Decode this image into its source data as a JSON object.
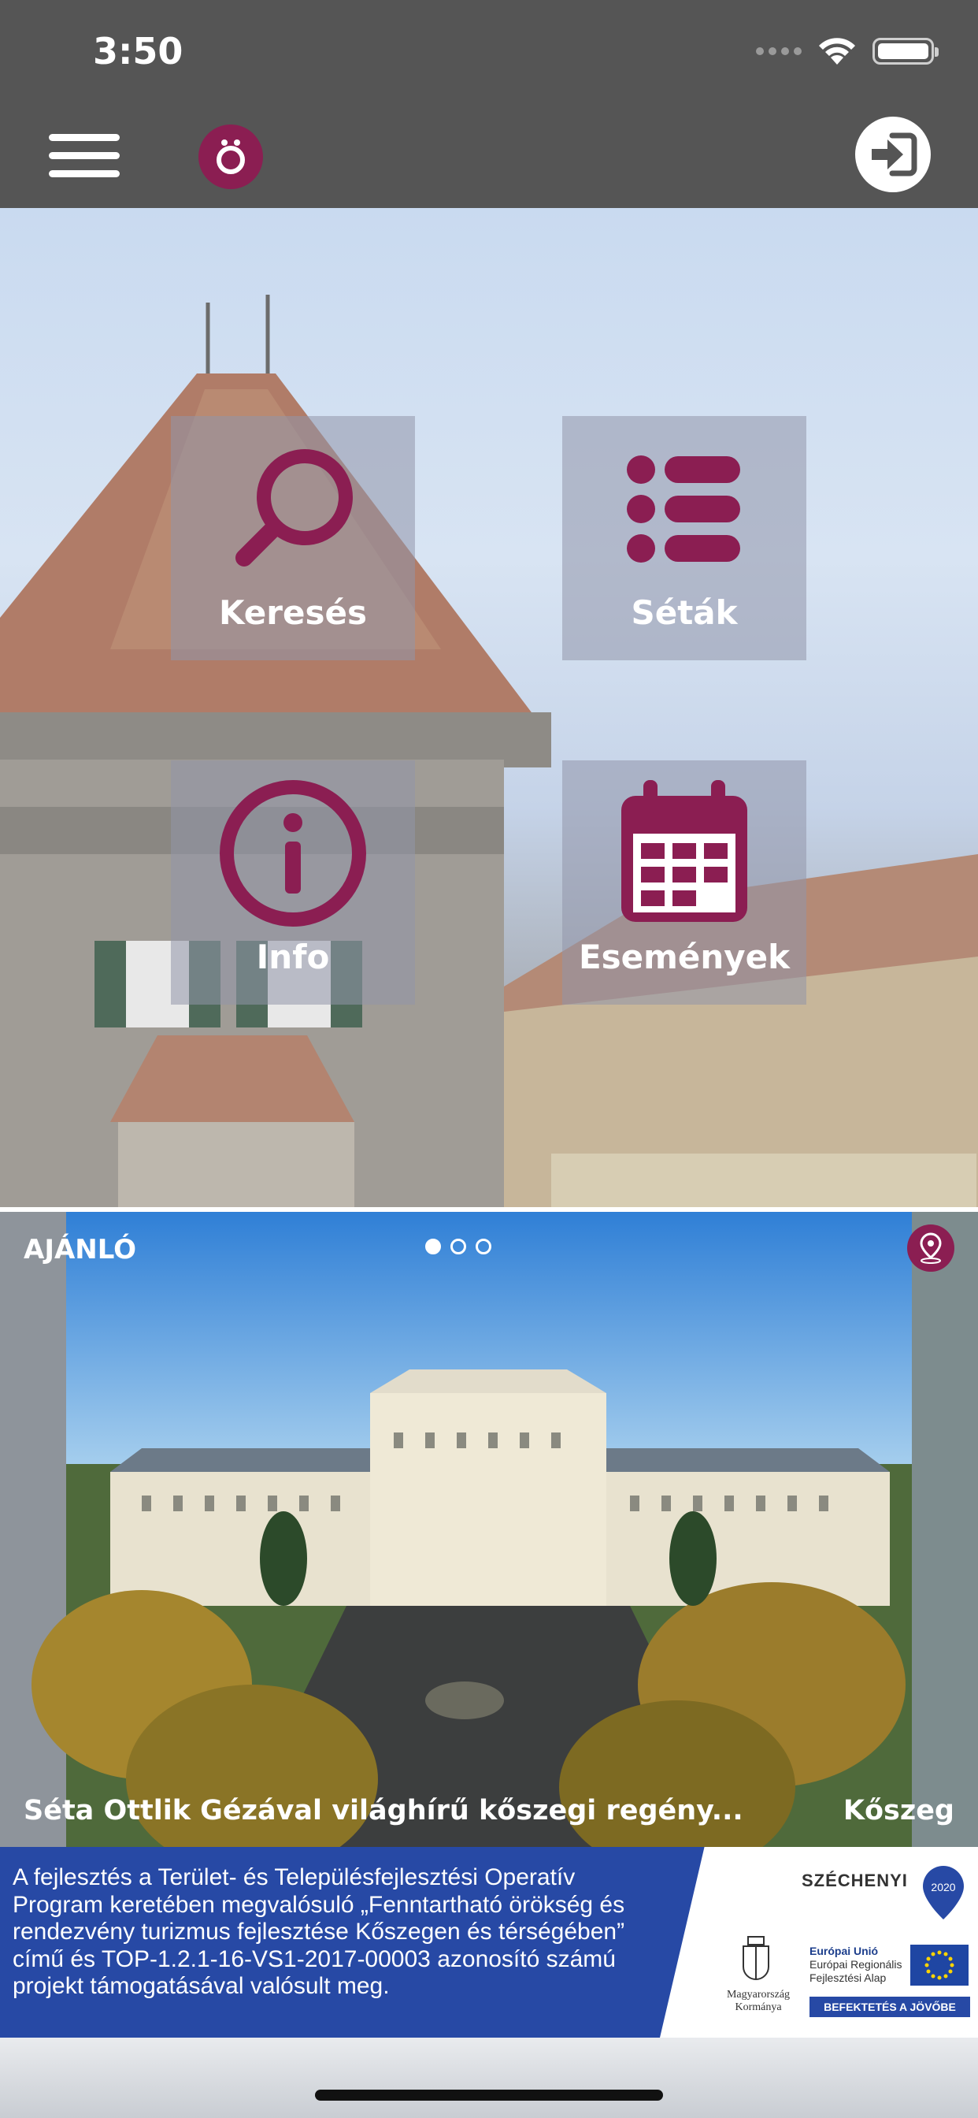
{
  "status_bar": {
    "time": "3:50"
  },
  "header": {
    "menu_icon": "hamburger-menu-icon",
    "logo_icon": "app-logo-icon",
    "login_icon": "login-icon"
  },
  "tiles": [
    {
      "label": "Keresés",
      "icon": "search-icon"
    },
    {
      "label": "Séták",
      "icon": "list-icon"
    },
    {
      "label": "Info",
      "icon": "info-icon"
    },
    {
      "label": "Események",
      "icon": "calendar-icon"
    }
  ],
  "carousel": {
    "section_label": "AJÁNLÓ",
    "page_count": 3,
    "active_page": 1,
    "caption": "Séta Ottlik Gézával világhírű kőszegi regény...",
    "location": "Kőszeg"
  },
  "banner": {
    "text": "A fejlesztés a Terület- és Településfejlesztési Operatív Program keretében megvalósuló „Fenntartható örökség és rendezvény turizmus fejlesztése Kőszegen és térségében” című és TOP-1.2.1-16-VS1-2017-00003 azonosító számú projekt támogatásával valósult meg.",
    "szechenyi": "SZÉCHENYI",
    "szechenyi_year": "2020",
    "kormany_line1": "Magyarország",
    "kormany_line2": "Kormánya",
    "eu_line1": "Európai Unió",
    "eu_line2": "Európai Regionális",
    "eu_line3": "Fejlesztési Alap",
    "befektetes": "BEFEKTETÉS A JÖVŐBE"
  },
  "colors": {
    "accent": "#8b1e52",
    "topbar": "#555555",
    "banner": "#2749a5"
  }
}
